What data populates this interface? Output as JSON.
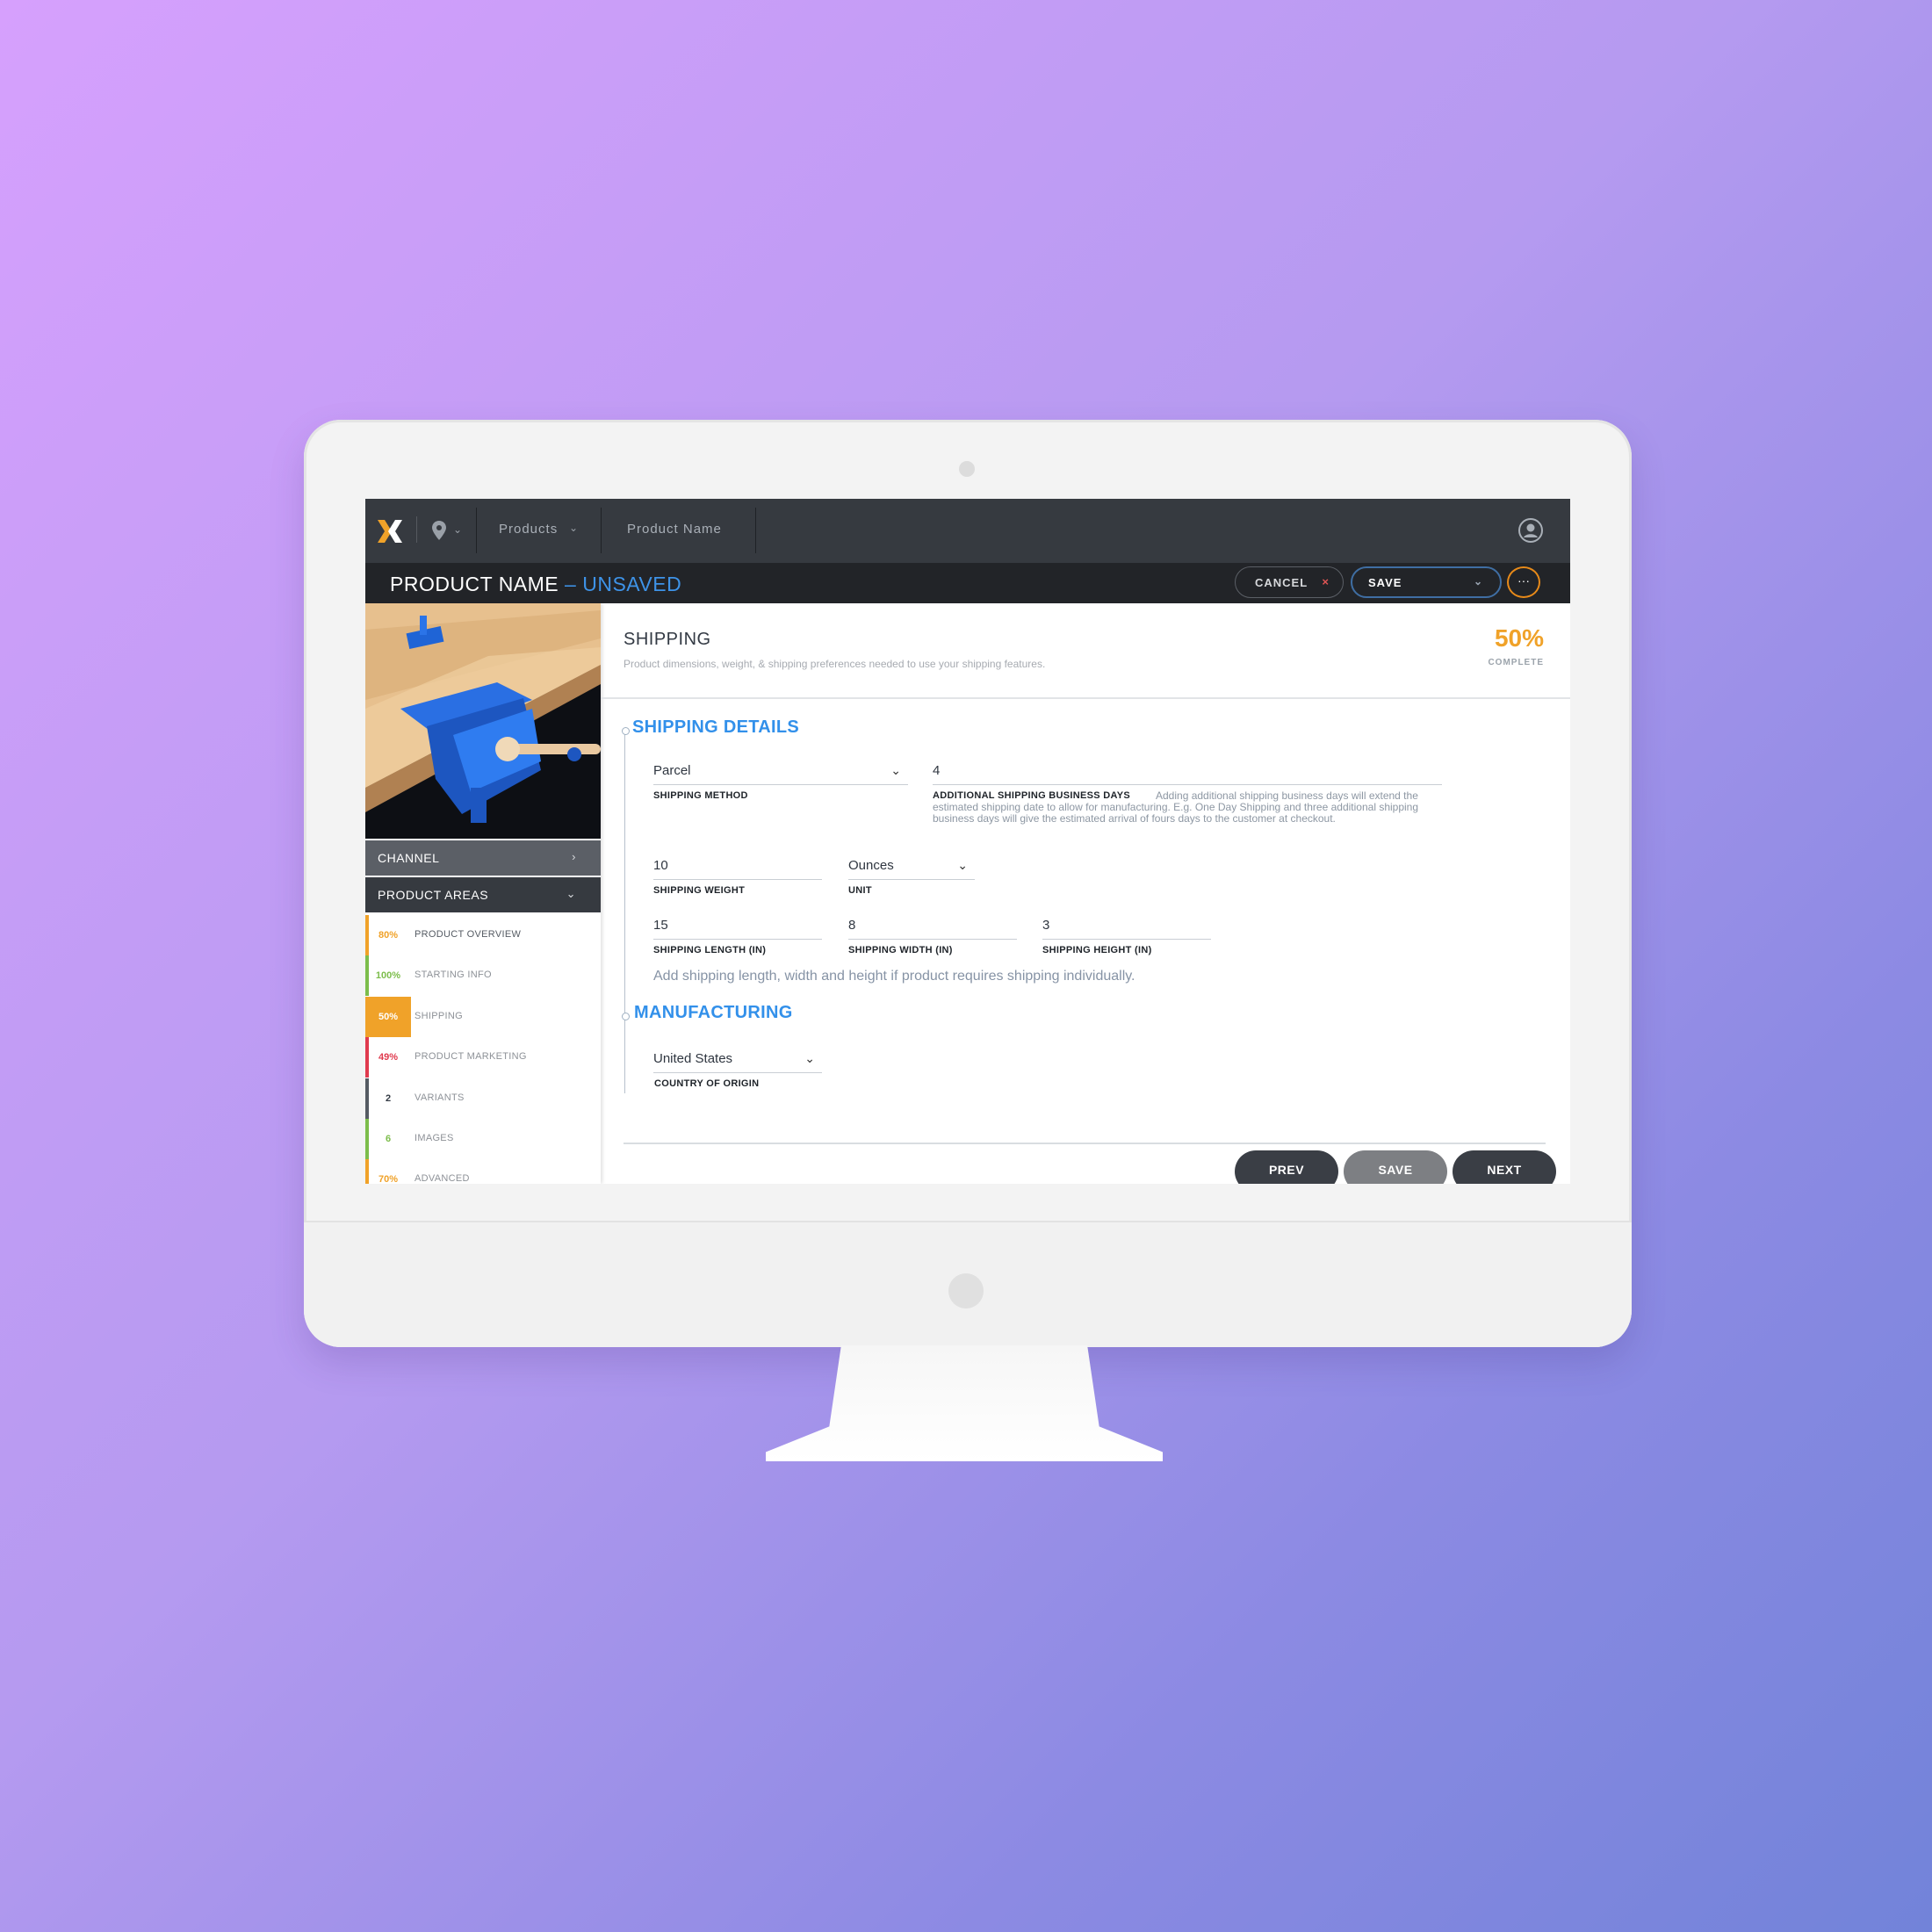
{
  "nav": {
    "products_label": "Products",
    "product_name_label": "Product Name"
  },
  "header": {
    "title": "PRODUCT NAME",
    "status": "– UNSAVED",
    "cancel_label": "CANCEL",
    "cancel_icon": "×",
    "save_label": "SAVE",
    "more_label": "···"
  },
  "sidebar": {
    "channel_label": "CHANNEL",
    "product_areas_label": "PRODUCT AREAS",
    "areas": [
      {
        "pct": "80%",
        "name": "PRODUCT OVERVIEW",
        "color": "#f0a229"
      },
      {
        "pct": "100%",
        "name": "STARTING INFO",
        "color": "#7cbd4b"
      },
      {
        "pct": "50%",
        "name": "SHIPPING",
        "color": "#f0a229"
      },
      {
        "pct": "49%",
        "name": "PRODUCT MARKETING",
        "color": "#e03a4e"
      },
      {
        "pct": "2",
        "name": "VARIANTS",
        "color": "#555b63"
      },
      {
        "pct": "6",
        "name": "IMAGES",
        "color": "#7cbd4b"
      },
      {
        "pct": "70%",
        "name": "ADVANCED",
        "color": "#f0a229"
      }
    ]
  },
  "main": {
    "section_title": "SHIPPING",
    "section_desc": "Product dimensions, weight, & shipping preferences needed to use your shipping features.",
    "complete_pct": "50%",
    "complete_label": "COMPLETE",
    "shipping_details_title": "SHIPPING DETAILS",
    "shipping_method": {
      "value": "Parcel",
      "label": "SHIPPING METHOD"
    },
    "business_days": {
      "value": "4",
      "label": "ADDITIONAL SHIPPING BUSINESS DAYS",
      "help": "Adding additional shipping business days will extend the estimated shipping date to allow for manufacturing. E.g. One Day Shipping and three additional shipping business days will give the estimated arrival of fours days to the customer at checkout."
    },
    "shipping_weight": {
      "value": "10",
      "label": "SHIPPING WEIGHT"
    },
    "unit": {
      "value": "Ounces",
      "label": "UNIT"
    },
    "length": {
      "value": "15",
      "label": "SHIPPING LENGTH (IN)"
    },
    "width": {
      "value": "8",
      "label": "SHIPPING WIDTH (IN)"
    },
    "height": {
      "value": "3",
      "label": "SHIPPING HEIGHT (IN)"
    },
    "dimensions_help": "Add shipping length, width and height if product requires shipping individually.",
    "manufacturing_title": "MANUFACTURING",
    "country": {
      "value": "United States",
      "label": "COUNTRY OF ORIGIN"
    },
    "prev_label": "PREV",
    "save_label": "SAVE",
    "next_label": "NEXT"
  },
  "colors": {
    "accent_blue": "#3290ea",
    "accent_orange": "#f0a229",
    "topbar": "#363a40",
    "titlebar": "#222428"
  }
}
